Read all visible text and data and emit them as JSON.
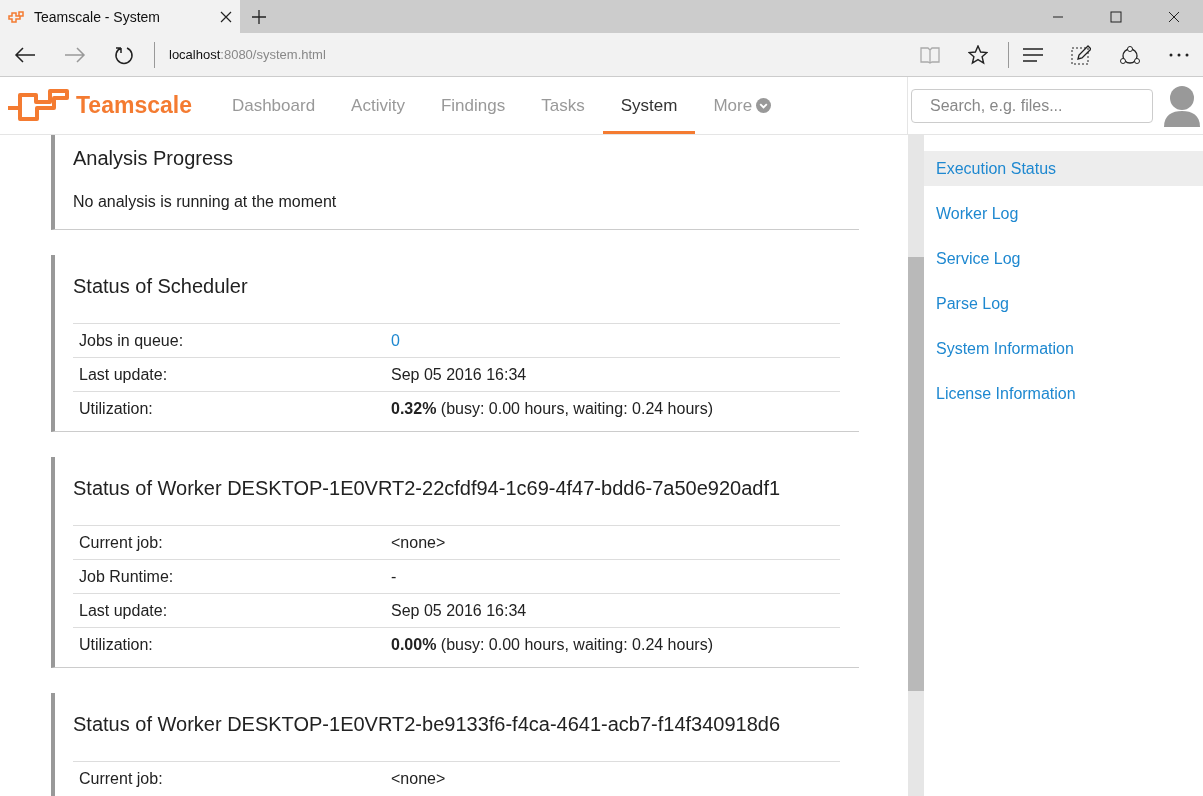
{
  "browser": {
    "tab_title": "Teamscale - System",
    "url_host": "localhost",
    "url_rest": ":8080/system.html"
  },
  "app": {
    "brand": "Teamscale",
    "nav": [
      {
        "label": "Dashboard",
        "selected": false
      },
      {
        "label": "Activity",
        "selected": false
      },
      {
        "label": "Findings",
        "selected": false
      },
      {
        "label": "Tasks",
        "selected": false
      },
      {
        "label": "System",
        "selected": true
      },
      {
        "label": "More",
        "selected": false,
        "kind": "dropdown"
      }
    ],
    "search": {
      "placeholder": "Search, e.g. files..."
    }
  },
  "sections": [
    {
      "title": "Analysis Progress",
      "text": "No analysis is running at the moment"
    },
    {
      "title": "Status of Scheduler",
      "rows": [
        {
          "label": "Jobs in queue:",
          "value": "0",
          "kind": "link"
        },
        {
          "label": "Last update:",
          "value": "Sep 05 2016 16:34",
          "kind": "text"
        },
        {
          "label": "Utilization:",
          "value": "**0.32%** (busy: 0.00 hours, waiting: 0.24 hours)",
          "kind": "text"
        }
      ]
    },
    {
      "title": "Status of Worker DESKTOP-1E0VRT2-22cfdf94-1c69-4f47-bdd6-7a50e920adf1",
      "rows": [
        {
          "label": "Current job:",
          "value": "<none>",
          "kind": "text"
        },
        {
          "label": "Job Runtime:",
          "value": "-",
          "kind": "text"
        },
        {
          "label": "Last update:",
          "value": "Sep 05 2016 16:34",
          "kind": "text"
        },
        {
          "label": "Utilization:",
          "value": "**0.00%** (busy: 0.00 hours, waiting: 0.24 hours)",
          "kind": "text"
        }
      ]
    },
    {
      "title": "Status of Worker DESKTOP-1E0VRT2-be9133f6-f4ca-4641-acb7-f14f340918d6",
      "rows": [
        {
          "label": "Current job:",
          "value": "<none>",
          "kind": "text"
        }
      ]
    }
  ],
  "sidebar": {
    "items": [
      {
        "label": "Execution Status",
        "selected": true
      },
      {
        "label": "Worker Log",
        "selected": false
      },
      {
        "label": "Service Log",
        "selected": false
      },
      {
        "label": "Parse Log",
        "selected": false
      },
      {
        "label": "System Information",
        "selected": false
      },
      {
        "label": "License Information",
        "selected": false
      }
    ]
  }
}
